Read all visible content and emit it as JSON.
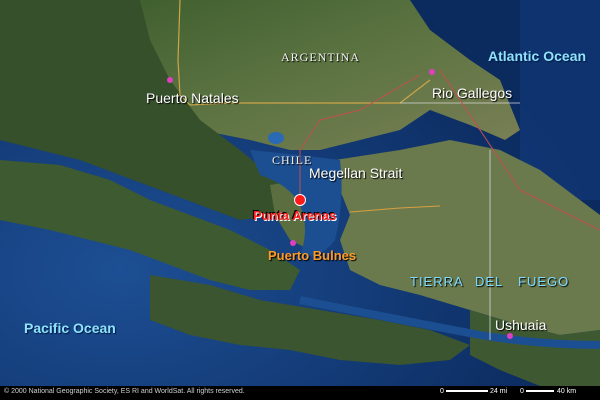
{
  "map": {
    "oceans": {
      "atlantic": "Atlantic Ocean",
      "pacific": "Pacific Ocean"
    },
    "countries": {
      "argentina": "ARGENTINA",
      "chile": "CHILE"
    },
    "water_features": {
      "strait": "Megellan Strait"
    },
    "places": {
      "puerto_natales": "Puerto Natales",
      "rio_gallegos": "Rio Gallegos",
      "punta_arenas": "Punta Arenas",
      "puerto_bulnes": "Puerto Bulnes",
      "ushuaia": "Ushuaia"
    },
    "regions": {
      "tdf_1": "TIERRA",
      "tdf_2": "DEL",
      "tdf_3": "FUEGO"
    }
  },
  "footer": {
    "copyright": "© 2000 National Geographic Society, ES RI and WorldSat. All rights reserved.",
    "scale_mi_zero": "0",
    "scale_mi": "24 mi",
    "scale_km_zero": "0",
    "scale_km": "40 km"
  },
  "colors": {
    "ocean": "#0e2f66",
    "land": "#4f6b3a",
    "capital_marker": "#ff1a1a",
    "town_marker": "#e040c0",
    "ocean_label": "#8fe3ff"
  }
}
